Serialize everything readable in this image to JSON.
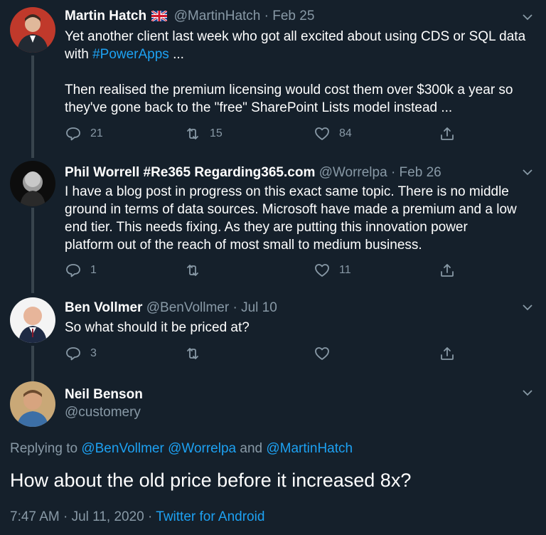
{
  "tweets": [
    {
      "name": "Martin Hatch",
      "handle": "@MartinHatch",
      "date": "Feb 25",
      "text_line1": "Yet another client last week who got all excited about using CDS or SQL data",
      "text_line2_prefix": "with ",
      "hashtag": "#PowerApps",
      "text_line2_suffix": " ...",
      "text_line3": "Then realised the premium licensing would cost them over $300k a year so",
      "text_line4": "they've gone back to the \"free\" SharePoint Lists model instead ...",
      "replies": "21",
      "retweets": "15",
      "likes": "84"
    },
    {
      "name": "Phil Worrell #Re365 Regarding365.com",
      "handle": "@Worrelpa",
      "date": "Feb 26",
      "lines": [
        "I have a blog post in progress on this exact same topic. There is no middle",
        "ground in terms of data sources. Microsoft have made a premium and a low",
        "end tier. This needs fixing. As they are putting this innovation power",
        "platform out of the reach of most small to medium business."
      ],
      "replies": "1",
      "retweets": "",
      "likes": "11"
    },
    {
      "name": "Ben Vollmer",
      "handle": "@BenVollmer",
      "date": "Jul 10",
      "text": "So what should it be priced at?",
      "replies": "3",
      "retweets": "",
      "likes": ""
    }
  ],
  "main_tweet": {
    "name": "Neil Benson",
    "handle": "@customery",
    "replying_prefix": "Replying to ",
    "replying_1": "@BenVollmer",
    "replying_2": "@Worrelpa",
    "replying_and": "and",
    "replying_3": "@MartinHatch",
    "text": "How about the old price before it increased 8x?",
    "time": "7:47 AM",
    "date": "Jul 11, 2020",
    "source": "Twitter for Android"
  },
  "separator_dot": "·",
  "colors": {
    "background": "#15202b",
    "secondary_text": "#8899a6",
    "link": "#1da1f2",
    "thread_line": "#38444d"
  },
  "icons": [
    "reply-icon",
    "retweet-icon",
    "like-icon",
    "share-icon",
    "chevron-down-icon",
    "uk-flag-icon"
  ]
}
